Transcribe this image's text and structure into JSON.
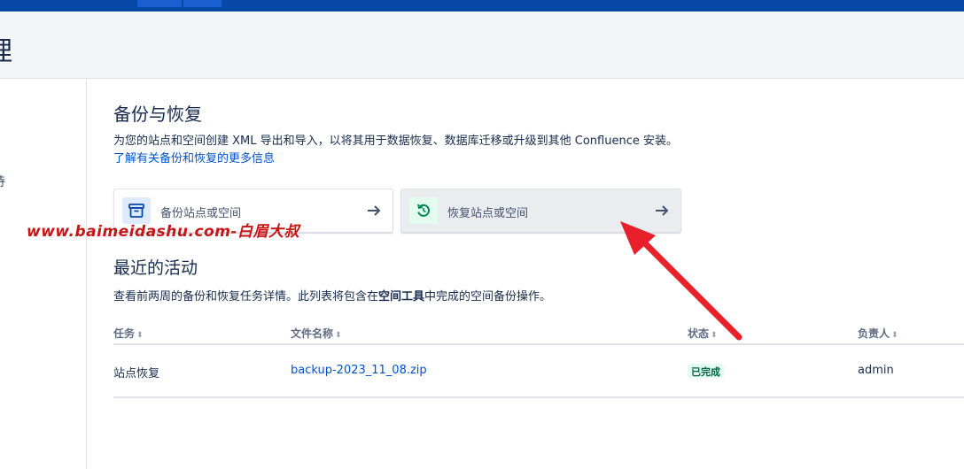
{
  "page_header": {
    "title": "理"
  },
  "sidebar": {
    "fragment": "待"
  },
  "main": {
    "heading": "备份与恢复",
    "description": "为您的站点和空间创建 XML 导出和导入，以将其用于数据恢复、数据库迁移或升级到其他 Confluence 安装。",
    "description_link": "了解有关备份和恢复的更多信息",
    "cards": [
      {
        "label": "备份站点或空间",
        "icon": "archive-box-icon"
      },
      {
        "label": "恢复站点或空间",
        "icon": "restore-icon"
      }
    ],
    "activity": {
      "heading": "最近的活动",
      "subtitle_before": "查看前两周的备份和恢复任务详情。此列表将包含在",
      "subtitle_bold": "空间工具",
      "subtitle_after": "中完成的空间备份操作。",
      "columns": [
        "任务",
        "文件名称",
        "状态",
        "负责人"
      ],
      "sort_glyph": "⬍",
      "rows": [
        {
          "task": "站点恢复",
          "file": "backup-2023_11_08.zip",
          "status": "已完成",
          "owner": "admin"
        }
      ]
    }
  },
  "overlay": {
    "watermark": "www.baimeidashu.com-白眉大叔",
    "arrow_color": "#e8202a"
  },
  "colors": {
    "topbar": "#0747a6",
    "link": "#0052cc",
    "status_bg": "#e3fcef",
    "status_text": "#006644"
  }
}
